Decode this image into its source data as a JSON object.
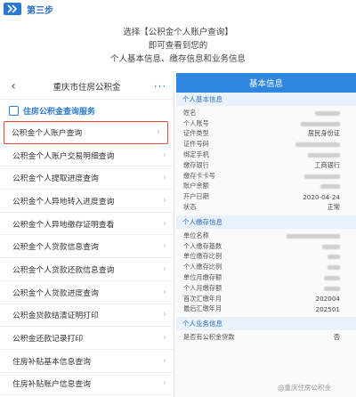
{
  "step": {
    "label": "第三步"
  },
  "intro": {
    "line1": "选择【公积金个人账户查询】",
    "line2": "即可查看到您的",
    "line3": "个人基本信息、缴存信息和业务信息"
  },
  "left_panel": {
    "nav": {
      "back": "‹",
      "title": "重庆市住房公积金",
      "more": "···"
    },
    "section": "住房公积金查询服务",
    "items": [
      "公积金个人账户查询",
      "公积金个人账户交易明细查询",
      "公积金个人提取进度查询",
      "公积金个人异地转入进度查询",
      "公积金个人异地缴存证明查看",
      "公积金个人贷款信息查询",
      "公积金个人贷款还款信息查询",
      "公积金个人贷款进度查询",
      "公积金贷款结清证明打印",
      "公积金还款记录打印",
      "住房补贴基本信息查询",
      "住房补贴账户信息查询"
    ],
    "highlighted_index": 0
  },
  "right_panel": {
    "header": "基本信息",
    "groups": [
      {
        "title": "个人基本信息",
        "rows": [
          {
            "k": "姓名",
            "v": ""
          },
          {
            "k": "个人账号",
            "v": ""
          },
          {
            "k": "证件类型",
            "v": "居民身份证"
          },
          {
            "k": "证件号码",
            "v": ""
          },
          {
            "k": "绑定手机",
            "v": ""
          },
          {
            "k": "缴存银行",
            "v": "工商银行"
          },
          {
            "k": "缴存卡卡号",
            "v": ""
          },
          {
            "k": "账户余额",
            "v": ""
          },
          {
            "k": "开户日期",
            "v": "2020-04-24"
          },
          {
            "k": "状态",
            "v": "正常"
          }
        ]
      },
      {
        "title": "个人缴存信息",
        "rows": [
          {
            "k": "单位名称",
            "v": ""
          },
          {
            "k": "个人缴存基数",
            "v": ""
          },
          {
            "k": "单位缴存比例",
            "v": ""
          },
          {
            "k": "个人缴存比例",
            "v": ""
          },
          {
            "k": "单位月缴存额",
            "v": ""
          },
          {
            "k": "个人月缴存额",
            "v": ""
          },
          {
            "k": "首次汇缴年月",
            "v": "202004"
          },
          {
            "k": "最后汇缴年月",
            "v": "202501"
          }
        ]
      },
      {
        "title": "个人业务信息",
        "rows": [
          {
            "k": "是否有公积金贷款",
            "v": "否"
          }
        ]
      }
    ]
  },
  "watermark": "@重庆住房公积金",
  "colors": {
    "brand_blue": "#2f86de",
    "highlight_red": "#e14a3b"
  }
}
